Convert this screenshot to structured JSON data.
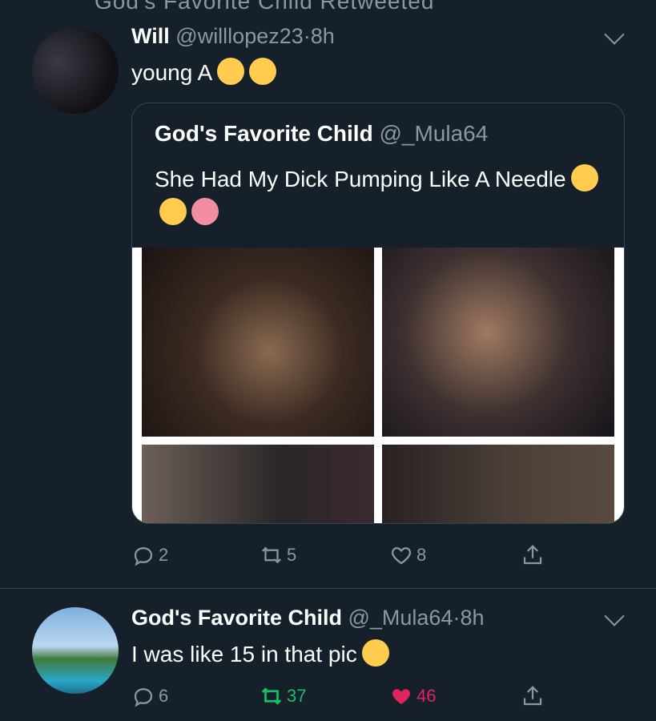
{
  "top_context": "God's Favorite Child Retweeted",
  "tweet1": {
    "name": "Will",
    "handle": "@willlopez23",
    "sep": "·",
    "time": "8h",
    "text": "young A",
    "emojis": [
      "rolling-laughing-emoji",
      "rolling-laughing-emoji"
    ],
    "quote": {
      "name": "God's Favorite Child",
      "handle": "@_Mula64",
      "text": "She Had My Dick Pumping Like A Needle",
      "emojis": [
        "heart-eyes-emoji",
        "kissing-heart-emoji",
        "tongue-emoji"
      ]
    },
    "actions": {
      "replies": "2",
      "retweets": "5",
      "likes": "8"
    }
  },
  "tweet2": {
    "name": "God's Favorite Child",
    "handle": "@_Mula64",
    "sep": "·",
    "time": "8h",
    "text": "I was like 15 in that pic",
    "emojis": [
      "sweat-smile-emoji"
    ],
    "actions": {
      "replies": "6",
      "retweets": "37",
      "likes": "46"
    }
  },
  "colors": {
    "background": "#15202b",
    "muted": "#8899a6",
    "retweet_active": "#17bf63",
    "like_active": "#e0245e",
    "border": "#38444d"
  }
}
